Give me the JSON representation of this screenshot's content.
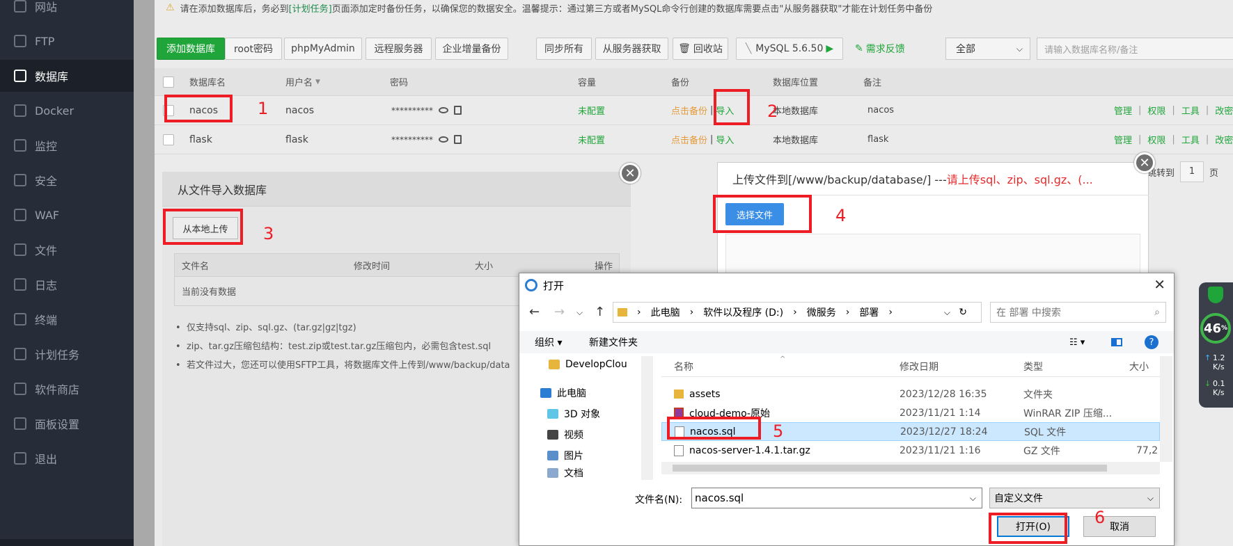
{
  "sidebar": {
    "items": [
      {
        "label": "网站",
        "icon": "globe-icon"
      },
      {
        "label": "FTP",
        "icon": "ftp-icon"
      },
      {
        "label": "数据库",
        "icon": "database-icon"
      },
      {
        "label": "Docker",
        "icon": "docker-icon"
      },
      {
        "label": "监控",
        "icon": "monitor-icon"
      },
      {
        "label": "安全",
        "icon": "shield-icon"
      },
      {
        "label": "WAF",
        "icon": "waf-shield-icon"
      },
      {
        "label": "文件",
        "icon": "folder-icon"
      },
      {
        "label": "日志",
        "icon": "log-icon"
      },
      {
        "label": "终端",
        "icon": "terminal-icon"
      },
      {
        "label": "计划任务",
        "icon": "calendar-icon"
      },
      {
        "label": "软件商店",
        "icon": "grid-icon"
      },
      {
        "label": "面板设置",
        "icon": "gear-icon"
      },
      {
        "label": "退出",
        "icon": "logout-icon"
      }
    ],
    "active": "数据库"
  },
  "notice": {
    "part1": "请在添加数据库后，务必到",
    "link": "[计划任务]",
    "part2": "页面添加定时备份任务，以确保您的数据安全。温馨提示：通过第三方或者MySQL命令行创建的数据库需要点击\"从服务器获取\"才能在计划任务中备份"
  },
  "toolbar": {
    "add_db": "添加数据库",
    "root_pwd": "root密码",
    "phpmyadmin": "phpMyAdmin",
    "remote_server": "远程服务器",
    "incremental_backup": "企业增量备份",
    "sync_all": "同步所有",
    "fetch_server": "从服务器获取",
    "recycle": "回收站",
    "mysql_version": "MySQL 5.6.50",
    "feedback": "需求反馈",
    "filter_value": "全部",
    "search_placeholder": "请输入数据库名称/备注"
  },
  "table": {
    "headers": [
      "数据库名",
      "用户名",
      "密码",
      "容量",
      "备份",
      "数据库位置",
      "备注"
    ],
    "rows": [
      {
        "name": "nacos",
        "user": "nacos",
        "password": "**********",
        "capacity": "未配置",
        "backup": "点击备份",
        "import": "导入",
        "location": "本地数据库",
        "note": "nacos"
      },
      {
        "name": "flask",
        "user": "flask",
        "password": "**********",
        "capacity": "未配置",
        "backup": "点击备份",
        "import": "导入",
        "location": "本地数据库",
        "note": "flask"
      }
    ],
    "actions": [
      "管理",
      "权限",
      "工具",
      "改密"
    ],
    "separator": "|",
    "jump_to": "跳转到",
    "page_num": "1",
    "page_suffix": "页"
  },
  "import_dialog": {
    "title": "从文件导入数据库",
    "upload_local": "从本地上传",
    "columns": [
      "文件名",
      "修改时间",
      "大小",
      "操作"
    ],
    "empty": "当前没有数据",
    "tips": [
      "仅支持sql、zip、sql.gz、(tar.gz|gz|tgz)",
      "zip、tar.gz压缩包结构：test.zip或test.tar.gz压缩包内，必需包含test.sql",
      "若文件过大，您还可以使用SFTP工具，将数据库文件上传到/www/backup/data"
    ]
  },
  "upload_dialog": {
    "title": "上传文件到[/www/backup/database/] --- ",
    "title_red": "请上传sql、zip、sql.gz、(...",
    "choose_file": "选择文件"
  },
  "open_dialog": {
    "title": "打开",
    "breadcrumb": [
      "此电脑",
      "软件以及程序 (D:)",
      "微服务",
      "部署"
    ],
    "search_placeholder": "在 部署 中搜索",
    "organize": "组织 ▾",
    "new_folder": "新建文件夹",
    "help": "?",
    "tree": [
      {
        "label": "DevelopClou",
        "icon": "folder-icon"
      },
      {
        "label": "此电脑",
        "icon": "computer-icon"
      },
      {
        "label": "3D 对象",
        "icon": "cube-icon"
      },
      {
        "label": "视频",
        "icon": "video-icon"
      },
      {
        "label": "图片",
        "icon": "picture-icon"
      },
      {
        "label": "文档",
        "icon": "document-icon"
      }
    ],
    "columns": [
      "名称",
      "修改日期",
      "类型",
      "大小"
    ],
    "files": [
      {
        "name": "assets",
        "date": "2023/12/28 16:35",
        "type": "文件夹",
        "size": "",
        "icon": "folder-icon",
        "selected": false
      },
      {
        "name": "cloud-demo-原始",
        "date": "2023/11/21 1:14",
        "type": "WinRAR ZIP 压缩...",
        "size": "",
        "icon": "winrar-icon",
        "selected": false
      },
      {
        "name": "nacos.sql",
        "date": "2023/12/27 18:24",
        "type": "SQL 文件",
        "size": "",
        "icon": "file-icon",
        "selected": true
      },
      {
        "name": "nacos-server-1.4.1.tar.gz",
        "date": "2023/11/21 1:16",
        "type": "GZ 文件",
        "size": "77,2",
        "icon": "file-icon",
        "selected": false
      }
    ],
    "filename_label": "文件名(N):",
    "filename_value": "nacos.sql",
    "filetype": "自定义文件",
    "open_btn": "打开(O)",
    "cancel_btn": "取消"
  },
  "annotations": [
    "1",
    "2",
    "3",
    "4",
    "5",
    "6"
  ],
  "widget": {
    "percent": "46",
    "percent_sign": "%",
    "up_speed": "1.2",
    "down_speed": "0.1",
    "unit": "K/s"
  },
  "colors": {
    "accent_green": "#20a53a",
    "annotation_red": "#ee1c24",
    "sidebar_bg": "#262c38"
  }
}
